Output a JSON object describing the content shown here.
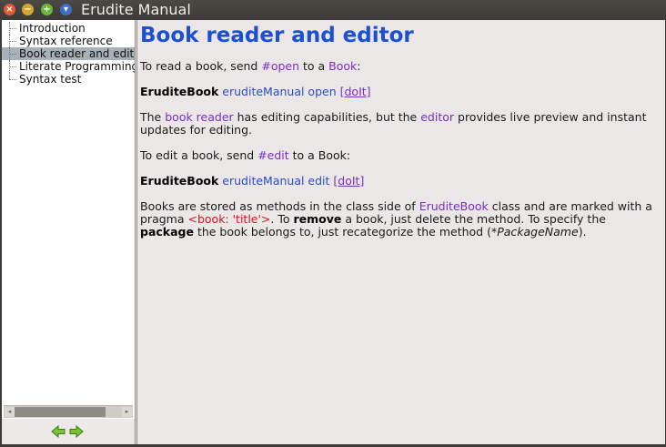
{
  "window": {
    "title": "Erudite Manual",
    "close_glyph": "×",
    "minimize_glyph": "−",
    "maximize_glyph": "+",
    "menu_glyph": "▾"
  },
  "sidebar": {
    "items": [
      {
        "label": "Introduction",
        "selected": false
      },
      {
        "label": "Syntax reference",
        "selected": false
      },
      {
        "label": "Book reader and editor",
        "selected": true
      },
      {
        "label": "Literate Programming",
        "selected": false
      },
      {
        "label": "Syntax test",
        "selected": false
      }
    ],
    "scroll_left": "◂",
    "scroll_right": "▸",
    "back_icon": "green-left-arrow-icon",
    "forward_icon": "green-right-arrow-icon"
  },
  "content": {
    "heading": "Book reader and editor",
    "p1": {
      "t1": "To read a book, send ",
      "sym": "#open",
      "t2": " to a ",
      "cls": "Book",
      "t3": ":"
    },
    "p2": {
      "bold": "EruditeBook",
      "code": " eruditeManual open ",
      "doit": "[doIt]"
    },
    "p3": {
      "t1": "The ",
      "link1": "book reader",
      "t2": " has editing capabilities, but the ",
      "link2": "editor",
      "t3": " provides live preview and instant updates for editing."
    },
    "p4": {
      "t1": "To edit a book, send ",
      "sym": "#edit",
      "t2": " to a Book:"
    },
    "p5": {
      "bold": "EruditeBook",
      "code": " eruditeManual edit ",
      "doit": "[doIt]"
    },
    "p6": {
      "t1": "Books are stored as methods in the class side of ",
      "cls": "EruditeBook",
      "t2": " class and are marked with a pragma ",
      "pragma": "<book: 'title'>",
      "t3": ". To ",
      "b1": "remove",
      "t4": " a book, just delete the method. To specify the ",
      "b2": "package",
      "t5": " the book belongs to, just recategorize the method (",
      "i1": "*PackageName",
      "t6": ")."
    }
  }
}
